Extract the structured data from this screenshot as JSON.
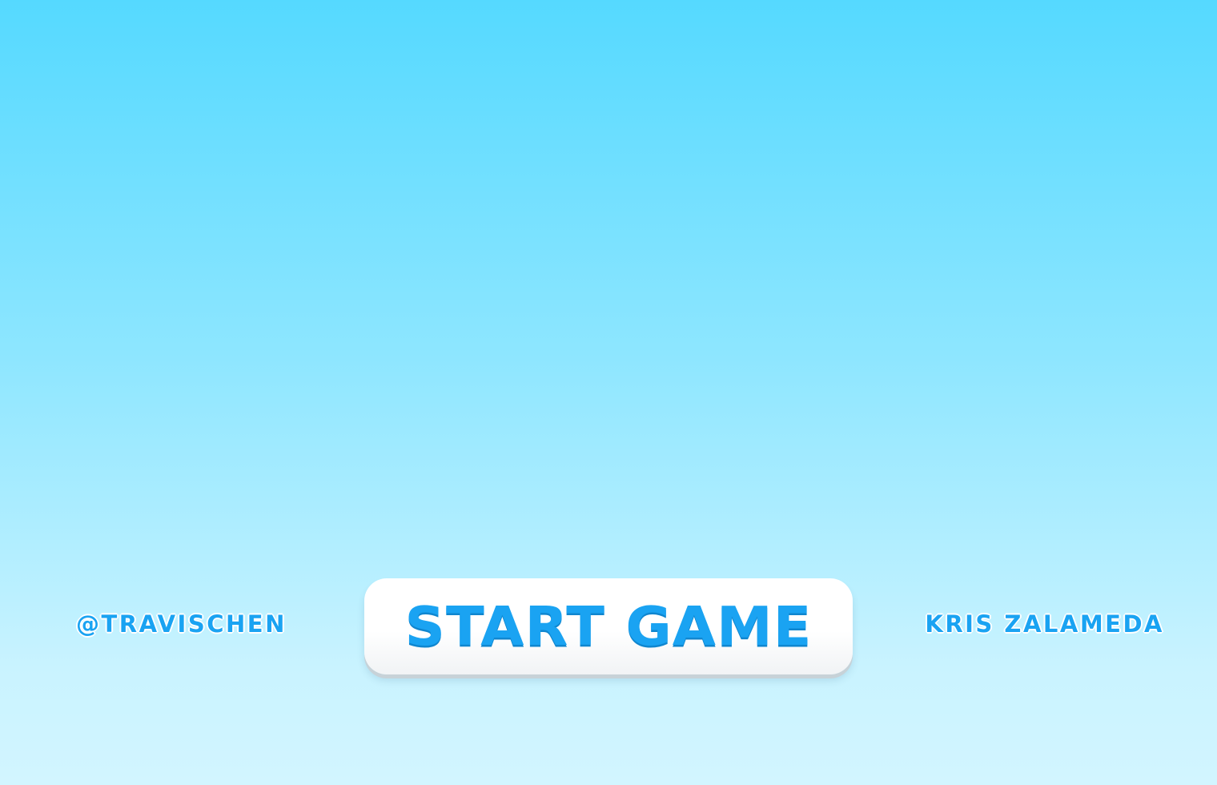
{
  "screen": {
    "background_colors": {
      "top": "#55d9ff",
      "bottom": "#d2f5ff"
    }
  },
  "credits": {
    "left": "@TRAVISCHEN",
    "right": "KRIS ZALAMEDA",
    "color": "#1aa3f2"
  },
  "start_button": {
    "label": "START GAME",
    "text_color": "#1aa3f2",
    "background_color": "#ffffff"
  }
}
